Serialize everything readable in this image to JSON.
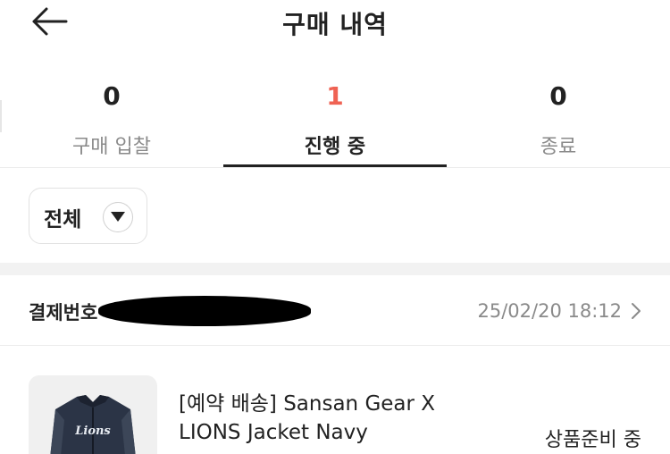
{
  "header": {
    "title": "구매 내역"
  },
  "tabs": [
    {
      "count": "0",
      "label": "구매 입찰"
    },
    {
      "count": "1",
      "label": "진행 중"
    },
    {
      "count": "0",
      "label": "종료"
    }
  ],
  "filter": {
    "label": "전체"
  },
  "order": {
    "label": "결제번호",
    "date": "25/02/20 18:12"
  },
  "product": {
    "name": "[예약 배송] Sansan Gear X LIONS Jacket Navy",
    "status": "상품준비 중",
    "logo_text": "Lions"
  },
  "colors": {
    "accent": "#ef6253",
    "text": "#222222",
    "muted": "#8a8a8a"
  }
}
